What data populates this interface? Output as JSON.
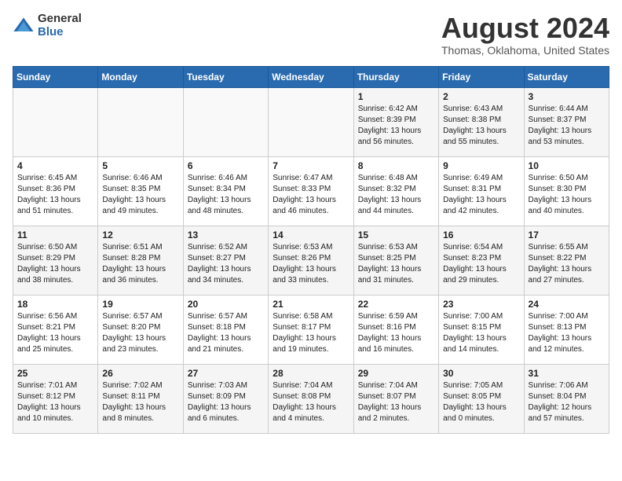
{
  "logo": {
    "general": "General",
    "blue": "Blue"
  },
  "title": {
    "month_year": "August 2024",
    "location": "Thomas, Oklahoma, United States"
  },
  "weekdays": [
    "Sunday",
    "Monday",
    "Tuesday",
    "Wednesday",
    "Thursday",
    "Friday",
    "Saturday"
  ],
  "weeks": [
    [
      {
        "day": "",
        "info": ""
      },
      {
        "day": "",
        "info": ""
      },
      {
        "day": "",
        "info": ""
      },
      {
        "day": "",
        "info": ""
      },
      {
        "day": "1",
        "info": "Sunrise: 6:42 AM\nSunset: 8:39 PM\nDaylight: 13 hours\nand 56 minutes."
      },
      {
        "day": "2",
        "info": "Sunrise: 6:43 AM\nSunset: 8:38 PM\nDaylight: 13 hours\nand 55 minutes."
      },
      {
        "day": "3",
        "info": "Sunrise: 6:44 AM\nSunset: 8:37 PM\nDaylight: 13 hours\nand 53 minutes."
      }
    ],
    [
      {
        "day": "4",
        "info": "Sunrise: 6:45 AM\nSunset: 8:36 PM\nDaylight: 13 hours\nand 51 minutes."
      },
      {
        "day": "5",
        "info": "Sunrise: 6:46 AM\nSunset: 8:35 PM\nDaylight: 13 hours\nand 49 minutes."
      },
      {
        "day": "6",
        "info": "Sunrise: 6:46 AM\nSunset: 8:34 PM\nDaylight: 13 hours\nand 48 minutes."
      },
      {
        "day": "7",
        "info": "Sunrise: 6:47 AM\nSunset: 8:33 PM\nDaylight: 13 hours\nand 46 minutes."
      },
      {
        "day": "8",
        "info": "Sunrise: 6:48 AM\nSunset: 8:32 PM\nDaylight: 13 hours\nand 44 minutes."
      },
      {
        "day": "9",
        "info": "Sunrise: 6:49 AM\nSunset: 8:31 PM\nDaylight: 13 hours\nand 42 minutes."
      },
      {
        "day": "10",
        "info": "Sunrise: 6:50 AM\nSunset: 8:30 PM\nDaylight: 13 hours\nand 40 minutes."
      }
    ],
    [
      {
        "day": "11",
        "info": "Sunrise: 6:50 AM\nSunset: 8:29 PM\nDaylight: 13 hours\nand 38 minutes."
      },
      {
        "day": "12",
        "info": "Sunrise: 6:51 AM\nSunset: 8:28 PM\nDaylight: 13 hours\nand 36 minutes."
      },
      {
        "day": "13",
        "info": "Sunrise: 6:52 AM\nSunset: 8:27 PM\nDaylight: 13 hours\nand 34 minutes."
      },
      {
        "day": "14",
        "info": "Sunrise: 6:53 AM\nSunset: 8:26 PM\nDaylight: 13 hours\nand 33 minutes."
      },
      {
        "day": "15",
        "info": "Sunrise: 6:53 AM\nSunset: 8:25 PM\nDaylight: 13 hours\nand 31 minutes."
      },
      {
        "day": "16",
        "info": "Sunrise: 6:54 AM\nSunset: 8:23 PM\nDaylight: 13 hours\nand 29 minutes."
      },
      {
        "day": "17",
        "info": "Sunrise: 6:55 AM\nSunset: 8:22 PM\nDaylight: 13 hours\nand 27 minutes."
      }
    ],
    [
      {
        "day": "18",
        "info": "Sunrise: 6:56 AM\nSunset: 8:21 PM\nDaylight: 13 hours\nand 25 minutes."
      },
      {
        "day": "19",
        "info": "Sunrise: 6:57 AM\nSunset: 8:20 PM\nDaylight: 13 hours\nand 23 minutes."
      },
      {
        "day": "20",
        "info": "Sunrise: 6:57 AM\nSunset: 8:18 PM\nDaylight: 13 hours\nand 21 minutes."
      },
      {
        "day": "21",
        "info": "Sunrise: 6:58 AM\nSunset: 8:17 PM\nDaylight: 13 hours\nand 19 minutes."
      },
      {
        "day": "22",
        "info": "Sunrise: 6:59 AM\nSunset: 8:16 PM\nDaylight: 13 hours\nand 16 minutes."
      },
      {
        "day": "23",
        "info": "Sunrise: 7:00 AM\nSunset: 8:15 PM\nDaylight: 13 hours\nand 14 minutes."
      },
      {
        "day": "24",
        "info": "Sunrise: 7:00 AM\nSunset: 8:13 PM\nDaylight: 13 hours\nand 12 minutes."
      }
    ],
    [
      {
        "day": "25",
        "info": "Sunrise: 7:01 AM\nSunset: 8:12 PM\nDaylight: 13 hours\nand 10 minutes."
      },
      {
        "day": "26",
        "info": "Sunrise: 7:02 AM\nSunset: 8:11 PM\nDaylight: 13 hours\nand 8 minutes."
      },
      {
        "day": "27",
        "info": "Sunrise: 7:03 AM\nSunset: 8:09 PM\nDaylight: 13 hours\nand 6 minutes."
      },
      {
        "day": "28",
        "info": "Sunrise: 7:04 AM\nSunset: 8:08 PM\nDaylight: 13 hours\nand 4 minutes."
      },
      {
        "day": "29",
        "info": "Sunrise: 7:04 AM\nSunset: 8:07 PM\nDaylight: 13 hours\nand 2 minutes."
      },
      {
        "day": "30",
        "info": "Sunrise: 7:05 AM\nSunset: 8:05 PM\nDaylight: 13 hours\nand 0 minutes."
      },
      {
        "day": "31",
        "info": "Sunrise: 7:06 AM\nSunset: 8:04 PM\nDaylight: 12 hours\nand 57 minutes."
      }
    ]
  ]
}
